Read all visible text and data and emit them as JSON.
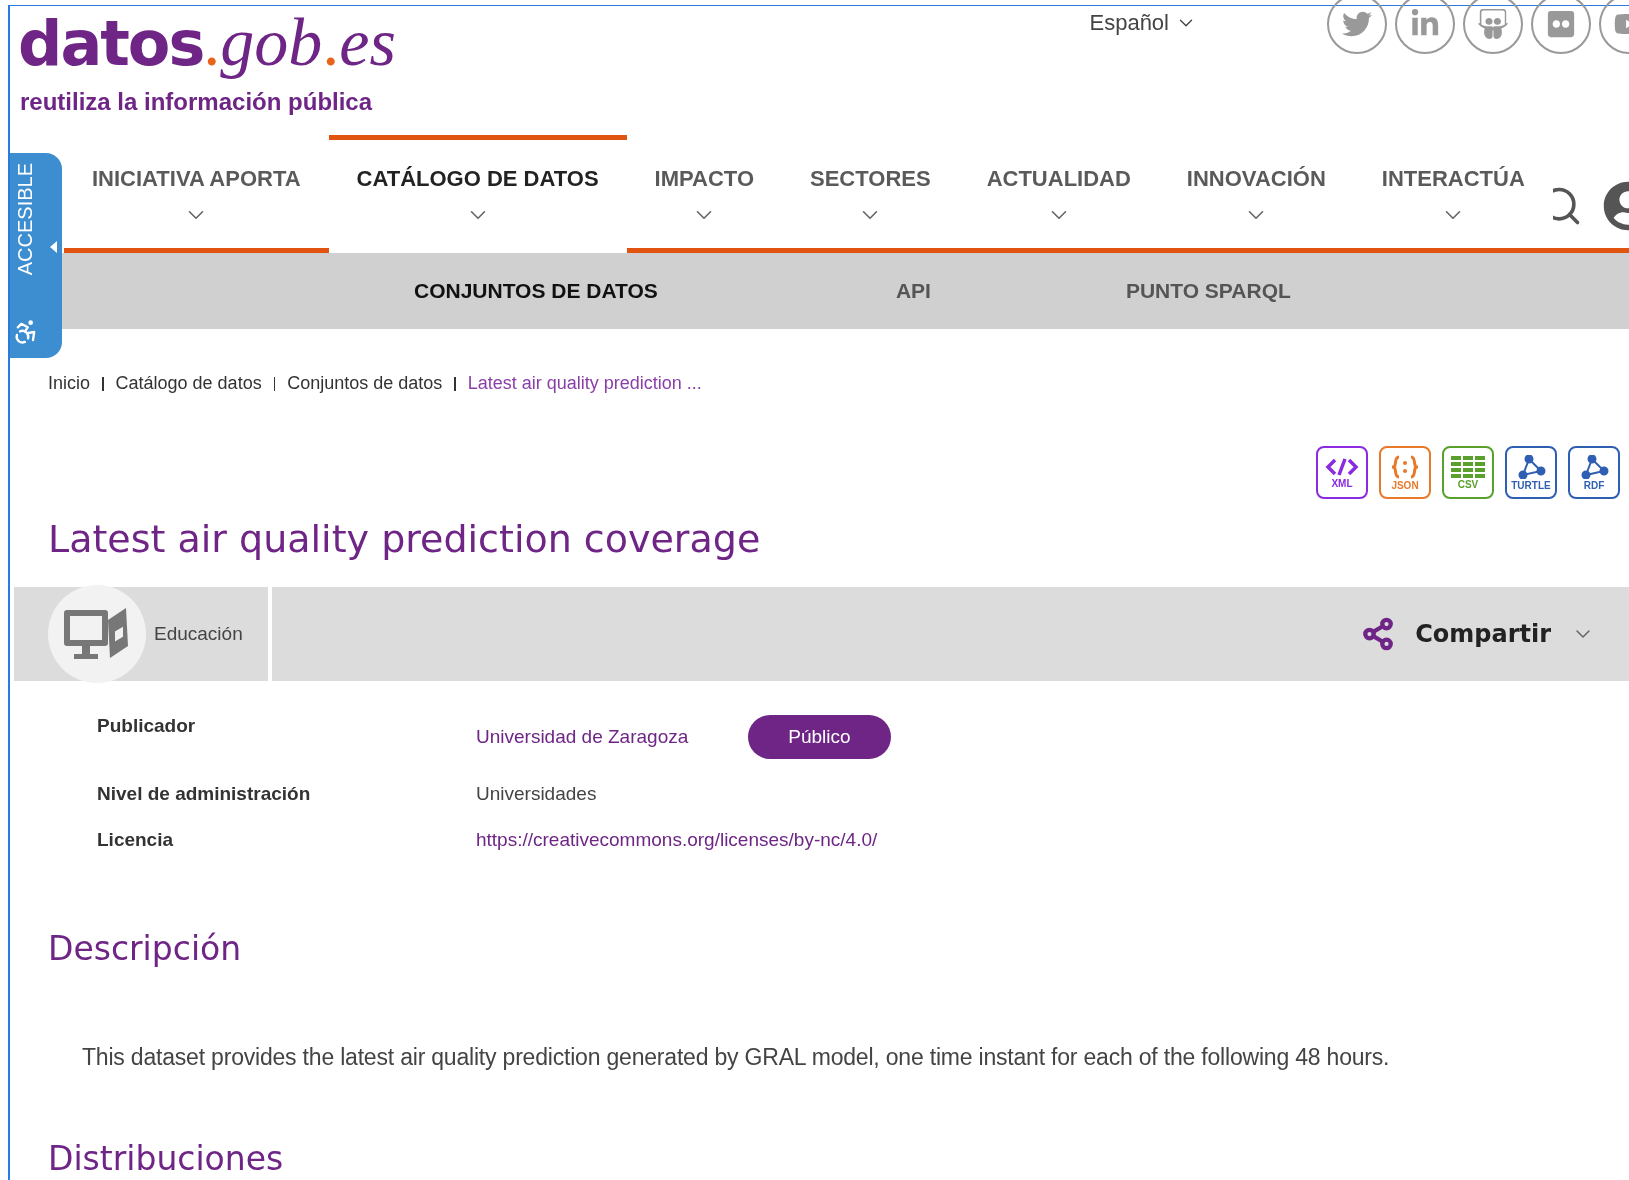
{
  "logo": {
    "parts": [
      {
        "text": "datos",
        "kind": "bold"
      },
      {
        "text": ".",
        "kind": "dot"
      },
      {
        "text": "gob",
        "kind": "italic"
      },
      {
        "text": ".",
        "kind": "dot"
      },
      {
        "text": "es",
        "kind": "italic"
      }
    ],
    "tagline": "reutiliza la información pública"
  },
  "language": "Español",
  "accessible_tab": "ACCESIBLE",
  "nav": [
    {
      "label": "INICIATIVA APORTA",
      "selected": false
    },
    {
      "label": "CATÁLOGO DE DATOS",
      "selected": true
    },
    {
      "label": "IMPACTO",
      "selected": false
    },
    {
      "label": "SECTORES",
      "selected": false
    },
    {
      "label": "ACTUALIDAD",
      "selected": false
    },
    {
      "label": "INNOVACIÓN",
      "selected": false
    },
    {
      "label": "INTERACTÚA",
      "selected": false
    }
  ],
  "subnav": [
    {
      "label": "CONJUNTOS DE DATOS",
      "selected": true
    },
    {
      "label": "API",
      "selected": false
    },
    {
      "label": "PUNTO SPARQL",
      "selected": false
    }
  ],
  "breadcrumb": [
    {
      "label": "Inicio",
      "current": false
    },
    {
      "label": "Catálogo de datos",
      "current": false
    },
    {
      "label": "Conjuntos de datos",
      "current": false
    },
    {
      "label": "Latest air quality prediction ...",
      "current": true
    }
  ],
  "formats": [
    {
      "label": "XML",
      "kind": "code",
      "color": "#8a2be2"
    },
    {
      "label": "JSON",
      "kind": "braces",
      "color": "#e8792a"
    },
    {
      "label": "CSV",
      "kind": "table",
      "color": "#5aa02c"
    },
    {
      "label": "TURTLE",
      "kind": "graph",
      "color": "#2f5fb3"
    },
    {
      "label": "RDF",
      "kind": "graph",
      "color": "#2f5fb3"
    }
  ],
  "title": "Latest air quality prediction coverage",
  "category": {
    "label": "Educación"
  },
  "share": {
    "label": "Compartir"
  },
  "details": [
    {
      "label": "Publicador",
      "value": "Universidad de Zaragoza",
      "kind": "link",
      "badge": "Público"
    },
    {
      "label": "Nivel de administración",
      "value": "Universidades",
      "kind": "text"
    },
    {
      "label": "Licencia",
      "value": "https://creativecommons.org/licenses/by-nc/4.0/",
      "kind": "link"
    }
  ],
  "description": {
    "heading": "Descripción",
    "text": "This dataset provides the latest air quality prediction generated by GRAL model, one time instant for each of the following 48 hours."
  },
  "distributions": {
    "heading": "Distribuciones"
  }
}
